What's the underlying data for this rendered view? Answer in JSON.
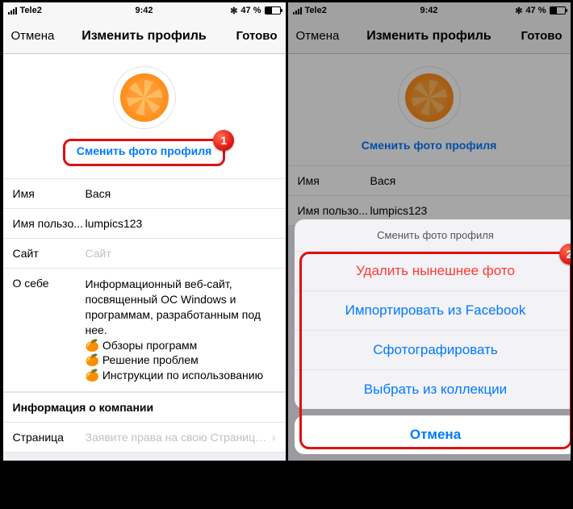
{
  "status": {
    "carrier": "Tele2",
    "time": "9:42",
    "bluetooth_icon": "✻",
    "battery_pct": "47 %"
  },
  "nav": {
    "cancel": "Отмена",
    "title": "Изменить профиль",
    "done": "Готово"
  },
  "profile": {
    "change_photo": "Сменить фото профиля"
  },
  "fields": {
    "name_label": "Имя",
    "name_value": "Вася",
    "username_label": "Имя пользо...",
    "username_value": "lumpics123",
    "site_label": "Сайт",
    "site_placeholder": "Сайт",
    "about_label": "О себе",
    "about_value": "Информационный веб-сайт, посвященный ОС Windows и программам, разработанным под нее.",
    "about_line1": "Обзоры программ",
    "about_line2": "Решение проблем",
    "about_line3": "Инструкции по использованию"
  },
  "section": {
    "company_info": "Информация о компании",
    "page_label": "Страница",
    "page_placeholder": "Заявите права на свою Страницу..."
  },
  "sheet": {
    "title": "Сменить фото профиля",
    "delete": "Удалить нынешнее фото",
    "import_fb": "Импортировать из Facebook",
    "take_photo": "Сфотографировать",
    "choose": "Выбрать из коллекции",
    "cancel": "Отмена"
  },
  "badges": {
    "one": "1",
    "two": "2"
  }
}
